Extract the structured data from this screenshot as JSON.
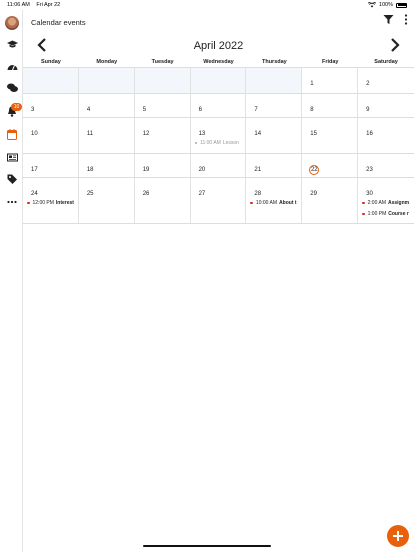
{
  "status_bar": {
    "time": "11:06 AM",
    "date": "Fri Apr 22",
    "battery": "100%"
  },
  "sidebar": {
    "notification_count": "10",
    "items": [
      "avatar",
      "graduation-cap-icon",
      "dashboard-icon",
      "chat-icon",
      "bell-icon",
      "calendar-icon",
      "news-icon",
      "tag-icon",
      "more-icon"
    ]
  },
  "header": {
    "title": "Calendar events"
  },
  "month": {
    "title": "April 2022"
  },
  "weekdays": [
    "Sunday",
    "Monday",
    "Tuesday",
    "Wednesday",
    "Thursday",
    "Friday",
    "Saturday"
  ],
  "weeks": [
    {
      "days": [
        {
          "num": "",
          "outside": true
        },
        {
          "num": "",
          "outside": true
        },
        {
          "num": "",
          "outside": true
        },
        {
          "num": "",
          "outside": true
        },
        {
          "num": "",
          "outside": true
        },
        {
          "num": "1"
        },
        {
          "num": "2"
        }
      ]
    },
    {
      "days": [
        {
          "num": "3"
        },
        {
          "num": "4"
        },
        {
          "num": "5"
        },
        {
          "num": "6"
        },
        {
          "num": "7"
        },
        {
          "num": "8"
        },
        {
          "num": "9"
        }
      ]
    },
    {
      "days": [
        {
          "num": "10"
        },
        {
          "num": "11"
        },
        {
          "num": "12"
        },
        {
          "num": "13",
          "events": [
            {
              "time": "11:00 AM",
              "title": "Lesson",
              "past": true
            }
          ]
        },
        {
          "num": "14"
        },
        {
          "num": "15"
        },
        {
          "num": "16"
        }
      ]
    },
    {
      "days": [
        {
          "num": "17"
        },
        {
          "num": "18"
        },
        {
          "num": "19"
        },
        {
          "num": "20"
        },
        {
          "num": "21"
        },
        {
          "num": "22",
          "today": true
        },
        {
          "num": "23"
        }
      ]
    },
    {
      "days": [
        {
          "num": "24",
          "events": [
            {
              "time": "12:00 PM",
              "title": "Interest"
            }
          ]
        },
        {
          "num": "25"
        },
        {
          "num": "26"
        },
        {
          "num": "27"
        },
        {
          "num": "28",
          "events": [
            {
              "time": "10:00 AM",
              "title": "About t"
            }
          ]
        },
        {
          "num": "29"
        },
        {
          "num": "30",
          "events": [
            {
              "time": "2:00 AM",
              "title": "Assignm"
            },
            {
              "time": "1:00 PM",
              "title": "Course r"
            }
          ]
        }
      ]
    }
  ]
}
